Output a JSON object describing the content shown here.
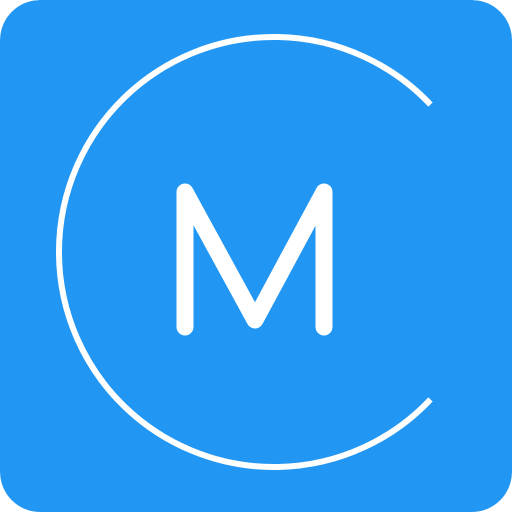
{
  "icon": {
    "name": "app-icon",
    "glyph": "M",
    "background_color": "#2196F3",
    "foreground_color": "#FFFFFF"
  }
}
